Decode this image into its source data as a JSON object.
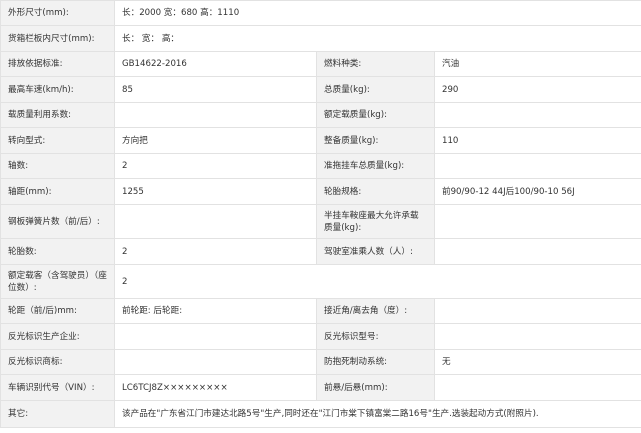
{
  "rows": [
    {
      "cells": [
        {
          "label": "外形尺寸(mm):",
          "value": "长：2000 宽：680 高：1110",
          "span": true
        }
      ]
    },
    {
      "cells": [
        {
          "label": "货箱栏板内尺寸(mm):",
          "value": "长：  宽：  高：",
          "span": true
        }
      ]
    },
    {
      "cells": [
        {
          "label": "排放依据标准:",
          "value": "GB14622-2016"
        },
        {
          "label": "燃料种类:",
          "value": "汽油"
        }
      ]
    },
    {
      "cells": [
        {
          "label": "最高车速(km/h):",
          "value": "85"
        },
        {
          "label": "总质量(kg):",
          "value": "290"
        }
      ]
    },
    {
      "cells": [
        {
          "label": "载质量利用系数:",
          "value": ""
        },
        {
          "label": "额定载质量(kg):",
          "value": ""
        }
      ]
    },
    {
      "cells": [
        {
          "label": "转向型式:",
          "value": "方向把"
        },
        {
          "label": "整备质量(kg):",
          "value": "110"
        }
      ]
    },
    {
      "cells": [
        {
          "label": "轴数:",
          "value": "2"
        },
        {
          "label": "准拖挂车总质量(kg):",
          "value": ""
        }
      ]
    },
    {
      "cells": [
        {
          "label": "轴距(mm):",
          "value": "1255"
        },
        {
          "label": "轮胎规格:",
          "value": "前90/90-12 44J后100/90-10 56J"
        }
      ]
    },
    {
      "cells": [
        {
          "label": "钢板弹簧片数（前/后）:",
          "value": ""
        },
        {
          "label": "半挂车鞍座最大允许承载质量(kg):",
          "value": ""
        }
      ]
    },
    {
      "cells": [
        {
          "label": "轮胎数:",
          "value": "2"
        },
        {
          "label": "驾驶室准乘人数（人）:",
          "value": ""
        }
      ]
    },
    {
      "cells": [
        {
          "label": "额定载客（含驾驶员）（座位数）:",
          "value": "2",
          "span": true
        }
      ]
    },
    {
      "cells": [
        {
          "label": "轮距（前/后)mm:",
          "value": "前轮距: 后轮距:"
        },
        {
          "label": "接近角/离去角（度）:",
          "value": ""
        }
      ]
    },
    {
      "cells": [
        {
          "label": "反光标识生产企业:",
          "value": ""
        },
        {
          "label": "反光标识型号:",
          "value": ""
        }
      ]
    },
    {
      "cells": [
        {
          "label": "反光标识商标:",
          "value": ""
        },
        {
          "label": "防抱死制动系统:",
          "value": "无"
        }
      ]
    },
    {
      "cells": [
        {
          "label": "车辆识别代号（VIN）:",
          "value": "LC6TCJ8Z×××××××××"
        },
        {
          "label": "前悬/后悬(mm):",
          "value": ""
        }
      ]
    },
    {
      "cells": [
        {
          "label": "其它:",
          "value": "该产品在\"广东省江门市建达北路5号\"生产,同时还在\"江门市棠下镇富棠二路16号\"生产.选装起动方式(附照片).",
          "span": true
        }
      ]
    }
  ]
}
